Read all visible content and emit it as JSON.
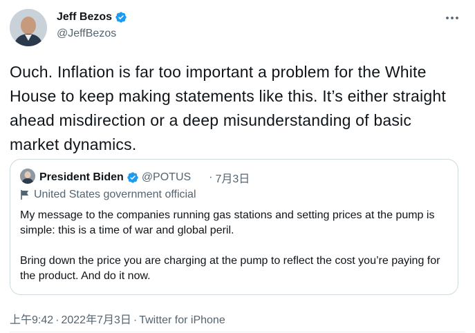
{
  "author": {
    "display_name": "Jeff Bezos",
    "handle": "@JeffBezos",
    "verified_icon": "verified-badge-icon"
  },
  "more_icon": "more-horizontal-icon",
  "tweet": {
    "text": "Ouch. Inflation is far too important a problem for the White House to keep making statements like this. It’s either straight ahead misdirection or a deep misunderstanding of basic market dynamics."
  },
  "quoted_tweet": {
    "display_name": "President Biden",
    "handle": "@POTUS",
    "dot": "·",
    "date": "7月3日",
    "label_icon": "flag-icon",
    "label": "United States government official",
    "paragraphs": [
      "My message to the companies running gas stations and setting prices at the pump is simple: this is a time of war and global peril.",
      "Bring down the price you are charging at the pump to reflect the cost you’re paying for the product. And do it now."
    ]
  },
  "meta": {
    "time": "上午9:42",
    "sep1": "·",
    "date": "2022年7月3日",
    "sep2": "·",
    "source": "Twitter for iPhone"
  },
  "colors": {
    "text": "#0f1419",
    "secondary": "#536471",
    "verified": "#1d9bf0",
    "border": "#cfd9de"
  }
}
